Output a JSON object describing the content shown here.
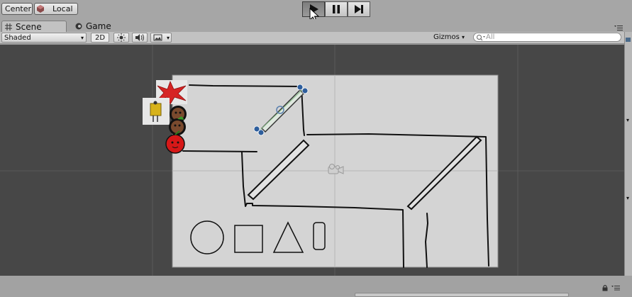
{
  "toolbar": {
    "pivot_label": "Center",
    "space_label": "Local",
    "play_state": "playing"
  },
  "tabs": [
    {
      "label": "Scene",
      "active": true
    },
    {
      "label": "Game",
      "active": false
    }
  ],
  "scene_bar": {
    "shading_mode": "Shaded",
    "mode_2d_label": "2D",
    "gizmos_label": "Gizmos",
    "search_placeholder": "All"
  },
  "colors": {
    "viewport_bg": "#474747",
    "sheet": "#d4d4d4",
    "ink": "#111111",
    "accent_blue": "#2e5e9c"
  },
  "icons": [
    "cursor-icon",
    "play-icon",
    "pause-icon",
    "step-icon",
    "unity-cube-icon",
    "grid-icon",
    "game-controller-icon",
    "light-icon",
    "audio-icon",
    "image-icon",
    "search-icon",
    "menu-icon",
    "camera-gizmo-icon",
    "lock-icon"
  ]
}
